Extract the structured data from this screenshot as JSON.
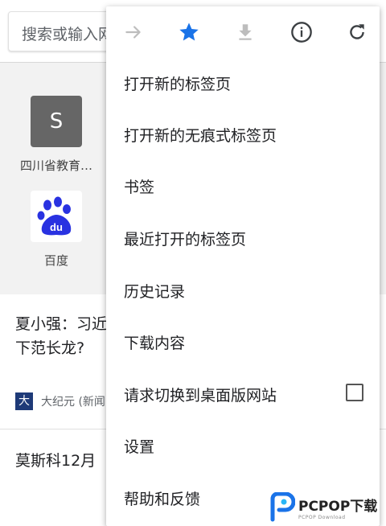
{
  "search": {
    "placeholder_text": "搜索或输入网址"
  },
  "tiles": [
    {
      "letter": "S",
      "label": "四川省教育…",
      "icon": "letter-tile"
    },
    {
      "label": "百度",
      "icon": "baidu-paw-icon",
      "logo_text": "du"
    }
  ],
  "news": {
    "headline_line1": "夏小强：习近",
    "headline_line2": "下范长龙?",
    "source_logo_text": "大",
    "source": "大纪元 (新闻",
    "headline2": "莫斯科12月"
  },
  "menu": {
    "toolbar_icons": [
      "forward-arrow-icon",
      "bookmark-star-icon",
      "download-icon",
      "info-icon",
      "reload-icon"
    ],
    "items": [
      {
        "label": "打开新的标签页"
      },
      {
        "label": "打开新的无痕式标签页"
      },
      {
        "label": "书签"
      },
      {
        "label": "最近打开的标签页"
      },
      {
        "label": "历史记录"
      },
      {
        "label": "下载内容"
      },
      {
        "label": "请求切换到桌面版网站",
        "checked": false
      },
      {
        "label": "设置"
      },
      {
        "label": "帮助和反馈"
      }
    ]
  },
  "watermark": {
    "brand": "PCPOP下载",
    "sub": "PCPOP Download"
  },
  "colors": {
    "accent_blue": "#1a73e8",
    "disabled_gray": "#bdbdbd",
    "icon_dark": "#5f6368",
    "baidu_blue": "#2932e1"
  }
}
